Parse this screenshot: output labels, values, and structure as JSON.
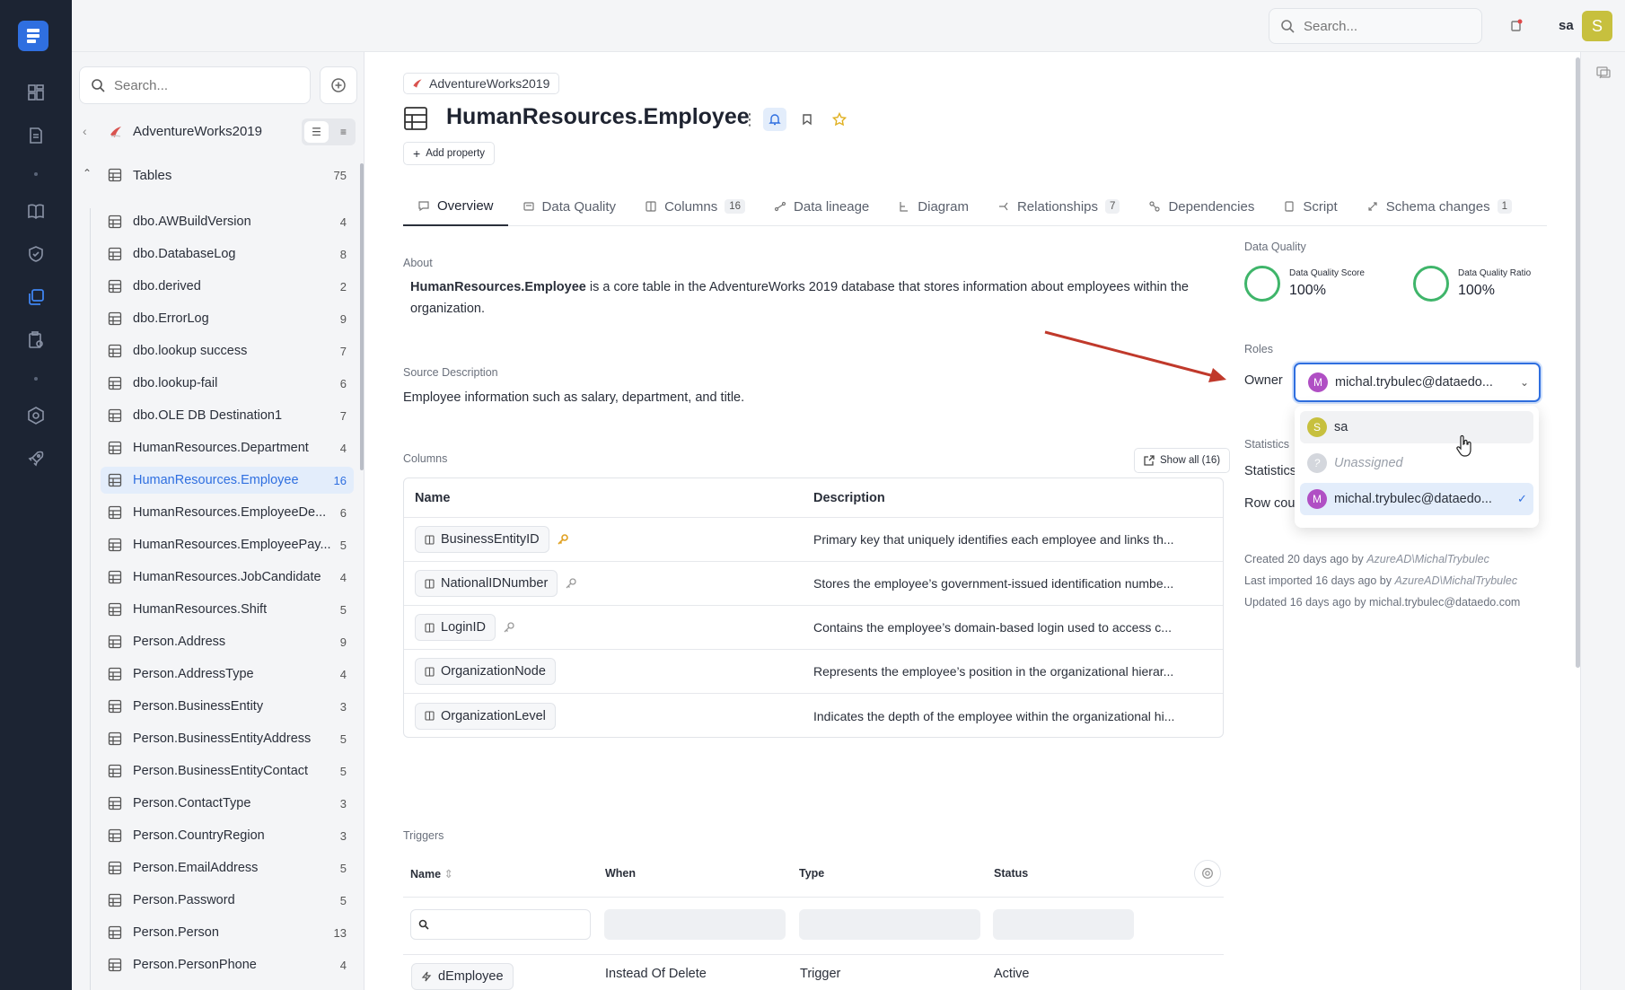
{
  "topbar": {
    "search_placeholder": "Search...",
    "user_name": "sa",
    "user_initial": "S"
  },
  "sidebar": {
    "search_placeholder": "Search...",
    "database": "AdventureWorks2019",
    "section_label": "Tables",
    "section_count": "75",
    "items": [
      {
        "label": "dbo.AWBuildVersion",
        "count": "4"
      },
      {
        "label": "dbo.DatabaseLog",
        "count": "8"
      },
      {
        "label": "dbo.derived",
        "count": "2"
      },
      {
        "label": "dbo.ErrorLog",
        "count": "9"
      },
      {
        "label": "dbo.lookup success",
        "count": "7"
      },
      {
        "label": "dbo.lookup-fail",
        "count": "6"
      },
      {
        "label": "dbo.OLE DB Destination1",
        "count": "7"
      },
      {
        "label": "HumanResources.Department",
        "count": "4"
      },
      {
        "label": "HumanResources.Employee",
        "count": "16"
      },
      {
        "label": "HumanResources.EmployeeDe...",
        "count": "6"
      },
      {
        "label": "HumanResources.EmployeePay...",
        "count": "5"
      },
      {
        "label": "HumanResources.JobCandidate",
        "count": "4"
      },
      {
        "label": "HumanResources.Shift",
        "count": "5"
      },
      {
        "label": "Person.Address",
        "count": "9"
      },
      {
        "label": "Person.AddressType",
        "count": "4"
      },
      {
        "label": "Person.BusinessEntity",
        "count": "3"
      },
      {
        "label": "Person.BusinessEntityAddress",
        "count": "5"
      },
      {
        "label": "Person.BusinessEntityContact",
        "count": "5"
      },
      {
        "label": "Person.ContactType",
        "count": "3"
      },
      {
        "label": "Person.CountryRegion",
        "count": "3"
      },
      {
        "label": "Person.EmailAddress",
        "count": "5"
      },
      {
        "label": "Person.Password",
        "count": "5"
      },
      {
        "label": "Person.Person",
        "count": "13"
      },
      {
        "label": "Person.PersonPhone",
        "count": "4"
      }
    ]
  },
  "main": {
    "breadcrumb": "AdventureWorks2019",
    "title": "HumanResources.Employee",
    "add_property": "Add property",
    "tabs": [
      {
        "label": "Overview",
        "badge": ""
      },
      {
        "label": "Data Quality",
        "badge": ""
      },
      {
        "label": "Columns",
        "badge": "16"
      },
      {
        "label": "Data lineage",
        "badge": ""
      },
      {
        "label": "Diagram",
        "badge": ""
      },
      {
        "label": "Relationships",
        "badge": "7"
      },
      {
        "label": "Dependencies",
        "badge": ""
      },
      {
        "label": "Script",
        "badge": ""
      },
      {
        "label": "Schema changes",
        "badge": "1"
      }
    ],
    "about_label": "About",
    "about_bold": "HumanResources.Employee",
    "about_text": " is a core table in the AdventureWorks 2019 database that stores information about employees within the organization.",
    "source_label": "Source Description",
    "source_text": "Employee information such as salary, department, and title.",
    "columns_label": "Columns",
    "show_all": "Show all (16)",
    "col_header_name": "Name",
    "col_header_desc": "Description",
    "columns": [
      {
        "name": "BusinessEntityID",
        "desc": "Primary key that uniquely identifies each employee and links th..."
      },
      {
        "name": "NationalIDNumber",
        "desc": "Stores the employee’s government-issued identification numbe..."
      },
      {
        "name": "LoginID",
        "desc": "Contains the employee’s domain-based login used to access c..."
      },
      {
        "name": "OrganizationNode",
        "desc": "Represents the employee’s position in the organizational hierar..."
      },
      {
        "name": "OrganizationLevel",
        "desc": "Indicates the depth of the employee within the organizational hi..."
      }
    ],
    "triggers_label": "Triggers",
    "trig_headers": {
      "name": "Name",
      "when": "When",
      "type": "Type",
      "status": "Status"
    },
    "trigger": {
      "name": "dEmployee",
      "when": "Instead Of Delete",
      "type": "Trigger",
      "status": "Active"
    }
  },
  "right": {
    "dq_label": "Data Quality",
    "dq_score_label": "Data Quality Score",
    "dq_score": "100%",
    "dq_ratio_label": "Data Quality Ratio",
    "dq_ratio": "100%",
    "roles_label": "Roles",
    "owner_label": "Owner",
    "owner_initial": "M",
    "owner_value": "michal.trybulec@dataedo...",
    "options": [
      {
        "initial": "S",
        "label": "sa"
      },
      {
        "initial": "?",
        "label": "Unassigned"
      },
      {
        "initial": "M",
        "label": "michal.trybulec@dataedo..."
      }
    ],
    "stats_label": "Statistics",
    "stats_row1": "Statistics",
    "stats_row2": "Row cou",
    "created_prefix": "Created 20 days ago by ",
    "created_by": "AzureAD\\MichalTrybulec",
    "imported_prefix": "Last imported 16 days ago by ",
    "imported_by": "AzureAD\\MichalTrybulec",
    "updated": "Updated 16 days ago by michal.trybulec@dataedo.com"
  },
  "colors": {
    "rail": "#1c2433",
    "accent": "#2f6fe0",
    "dq_ring": "#3fb56a",
    "arrow": "#c0392b"
  }
}
